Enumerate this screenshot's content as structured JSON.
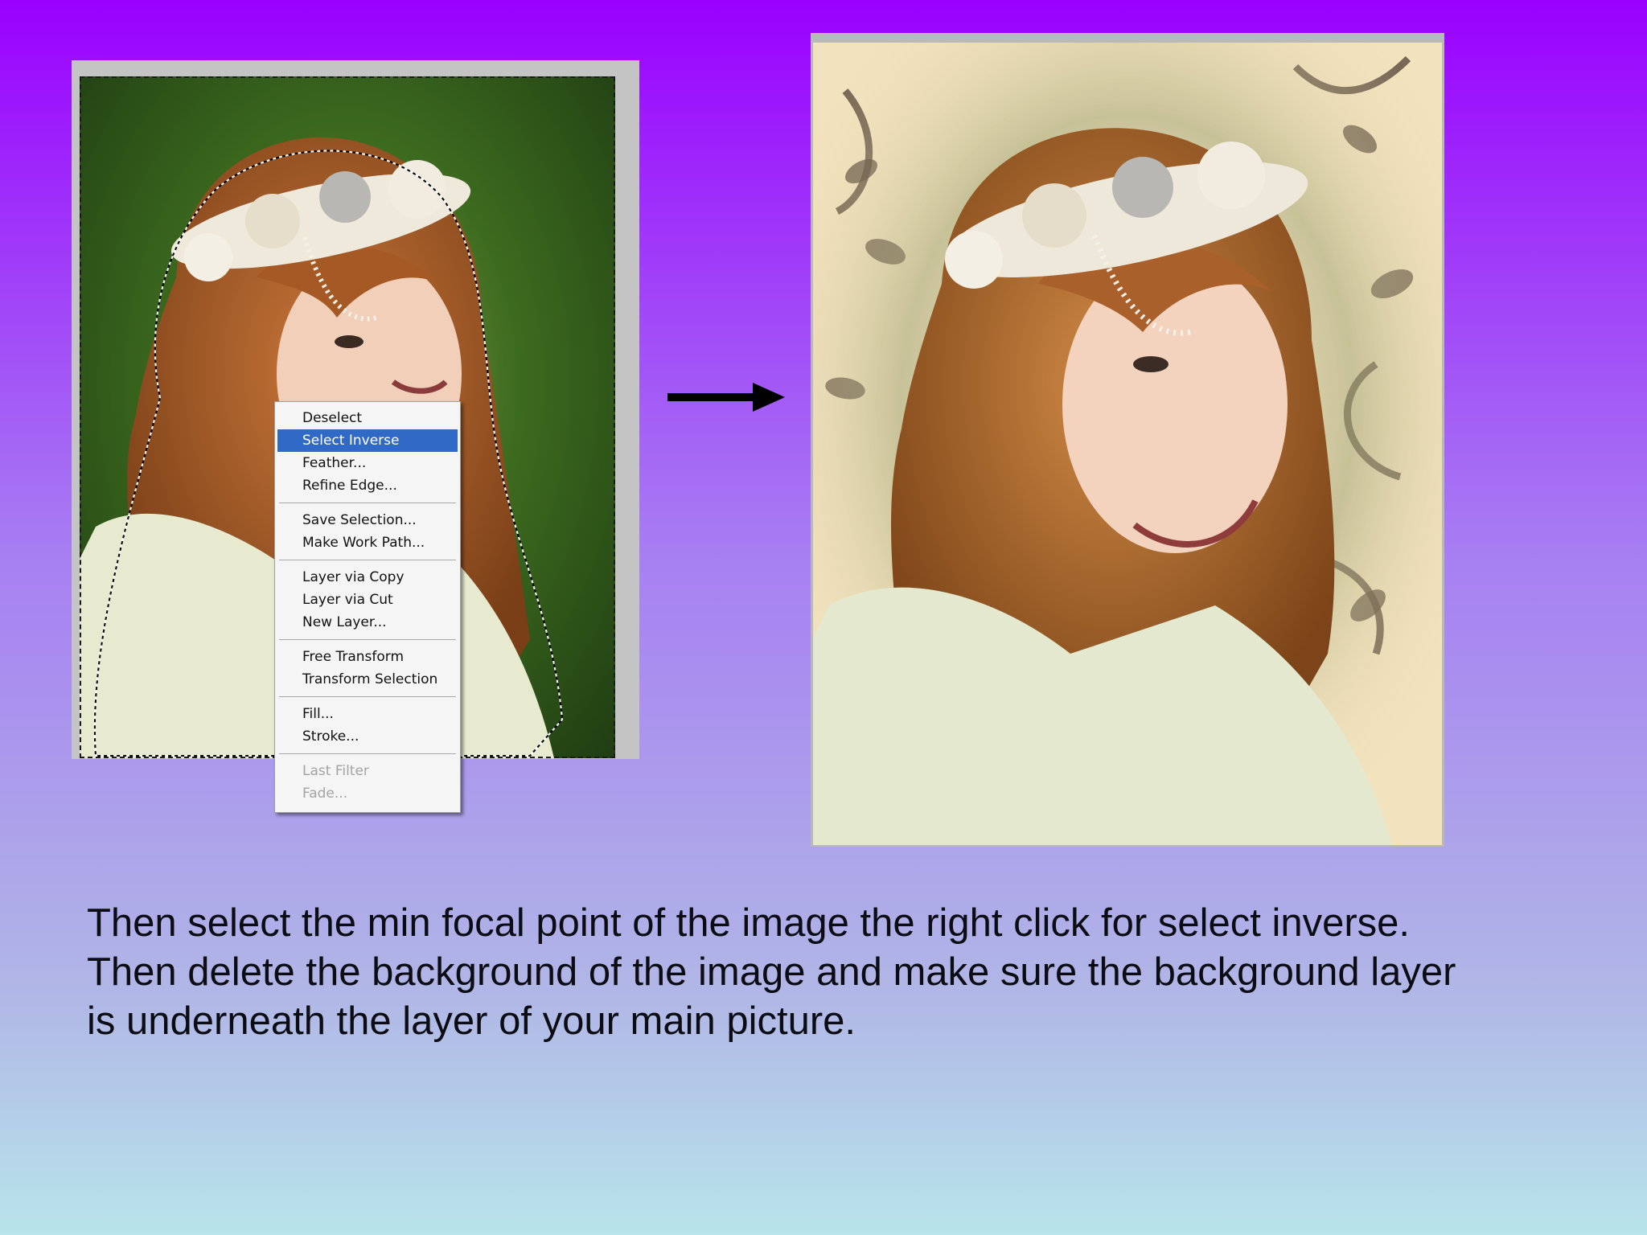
{
  "context_menu": {
    "groups": [
      [
        {
          "label": "Deselect",
          "state": "normal"
        },
        {
          "label": "Select Inverse",
          "state": "highlighted"
        },
        {
          "label": "Feather...",
          "state": "normal"
        },
        {
          "label": "Refine Edge...",
          "state": "normal"
        }
      ],
      [
        {
          "label": "Save Selection...",
          "state": "normal"
        },
        {
          "label": "Make Work Path...",
          "state": "normal"
        }
      ],
      [
        {
          "label": "Layer via Copy",
          "state": "normal"
        },
        {
          "label": "Layer via Cut",
          "state": "normal"
        },
        {
          "label": "New Layer...",
          "state": "normal"
        }
      ],
      [
        {
          "label": "Free Transform",
          "state": "normal"
        },
        {
          "label": "Transform Selection",
          "state": "normal"
        }
      ],
      [
        {
          "label": "Fill...",
          "state": "normal"
        },
        {
          "label": "Stroke...",
          "state": "normal"
        }
      ],
      [
        {
          "label": "Last Filter",
          "state": "disabled"
        },
        {
          "label": "Fade...",
          "state": "disabled"
        }
      ]
    ]
  },
  "caption": {
    "line1": "Then select the min focal point of the image the right click for select inverse.",
    "line2": "Then delete the background of the image and make sure the background layer",
    "line3": "is underneath the layer of your main picture."
  },
  "colors": {
    "highlight": "#3169c6",
    "arrow": "#000000"
  },
  "icons": {
    "arrow": "right-arrow-icon"
  }
}
